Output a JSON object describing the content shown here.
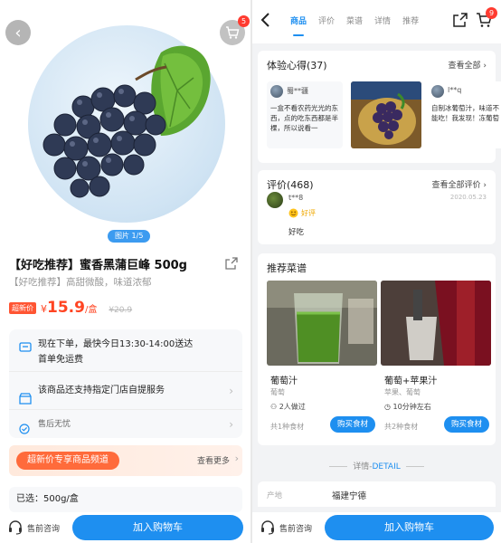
{
  "product": {
    "title": "【好吃推荐】蜜香黑蒲巨峰 500g",
    "subtitle": "【好吃推荐】高甜微酸，味道浓郁",
    "image_indicator": "图片 1/5",
    "cart_badge": "5",
    "price_tag": "超新价",
    "price_currency": "¥",
    "price": "15.9",
    "price_unit": "/盒",
    "original_price": "¥20.9",
    "delivery_line1": "现在下单，最快今日13:30-14:00送达",
    "delivery_line2": "首单免运费",
    "pickup_text": "该商品还支持指定门店自提服务",
    "after_sale_text": "售后无忧",
    "promo_pill": "超新价专享商品频道",
    "promo_more": "查看更多",
    "selected_text": "已选：500g/盒"
  },
  "bottom_bar": {
    "cs_label": "售前咨询",
    "add_cart_label": "加入购物车"
  },
  "right_nav": {
    "tabs": [
      {
        "label": "商品"
      },
      {
        "label": "评价"
      },
      {
        "label": "菜谱"
      },
      {
        "label": "详情"
      },
      {
        "label": "推荐"
      }
    ],
    "cart_badge": "9"
  },
  "experience": {
    "title": "体验心得(37)",
    "view_all": "查看全部",
    "left_user": "蜀**疆",
    "left_text": "一盒不看农药光光的东西，点的吃东西都是半棵，所以说看一",
    "right_user": "l**q",
    "right_text": "自制冰葡萄汁，味道不能吃！我发现！冻葡萄"
  },
  "reviews": {
    "title": "评价(468)",
    "view_all": "查看全部评价",
    "user": "t**8",
    "date": "2020.05.23",
    "tag": "好评",
    "text": "好吃"
  },
  "recipes": {
    "title": "推荐菜谱",
    "items": [
      {
        "name": "葡萄汁",
        "ingredients": "葡萄",
        "meta": "2人做过",
        "count": "共1种食材",
        "buy": "购买食材"
      },
      {
        "name": "葡萄+苹果汁",
        "ingredients": "苹果、葡萄",
        "meta": "10分钟左右",
        "count": "共2种食材",
        "buy": "购买食材"
      }
    ]
  },
  "detail": {
    "separator": "详情-",
    "separator_latin": "DETAIL",
    "origin_key": "产地",
    "origin_value": "福建宁德"
  },
  "colors": {
    "accent": "#1e8ff0",
    "price": "#ff4422",
    "promo": "#ff6b3b"
  }
}
